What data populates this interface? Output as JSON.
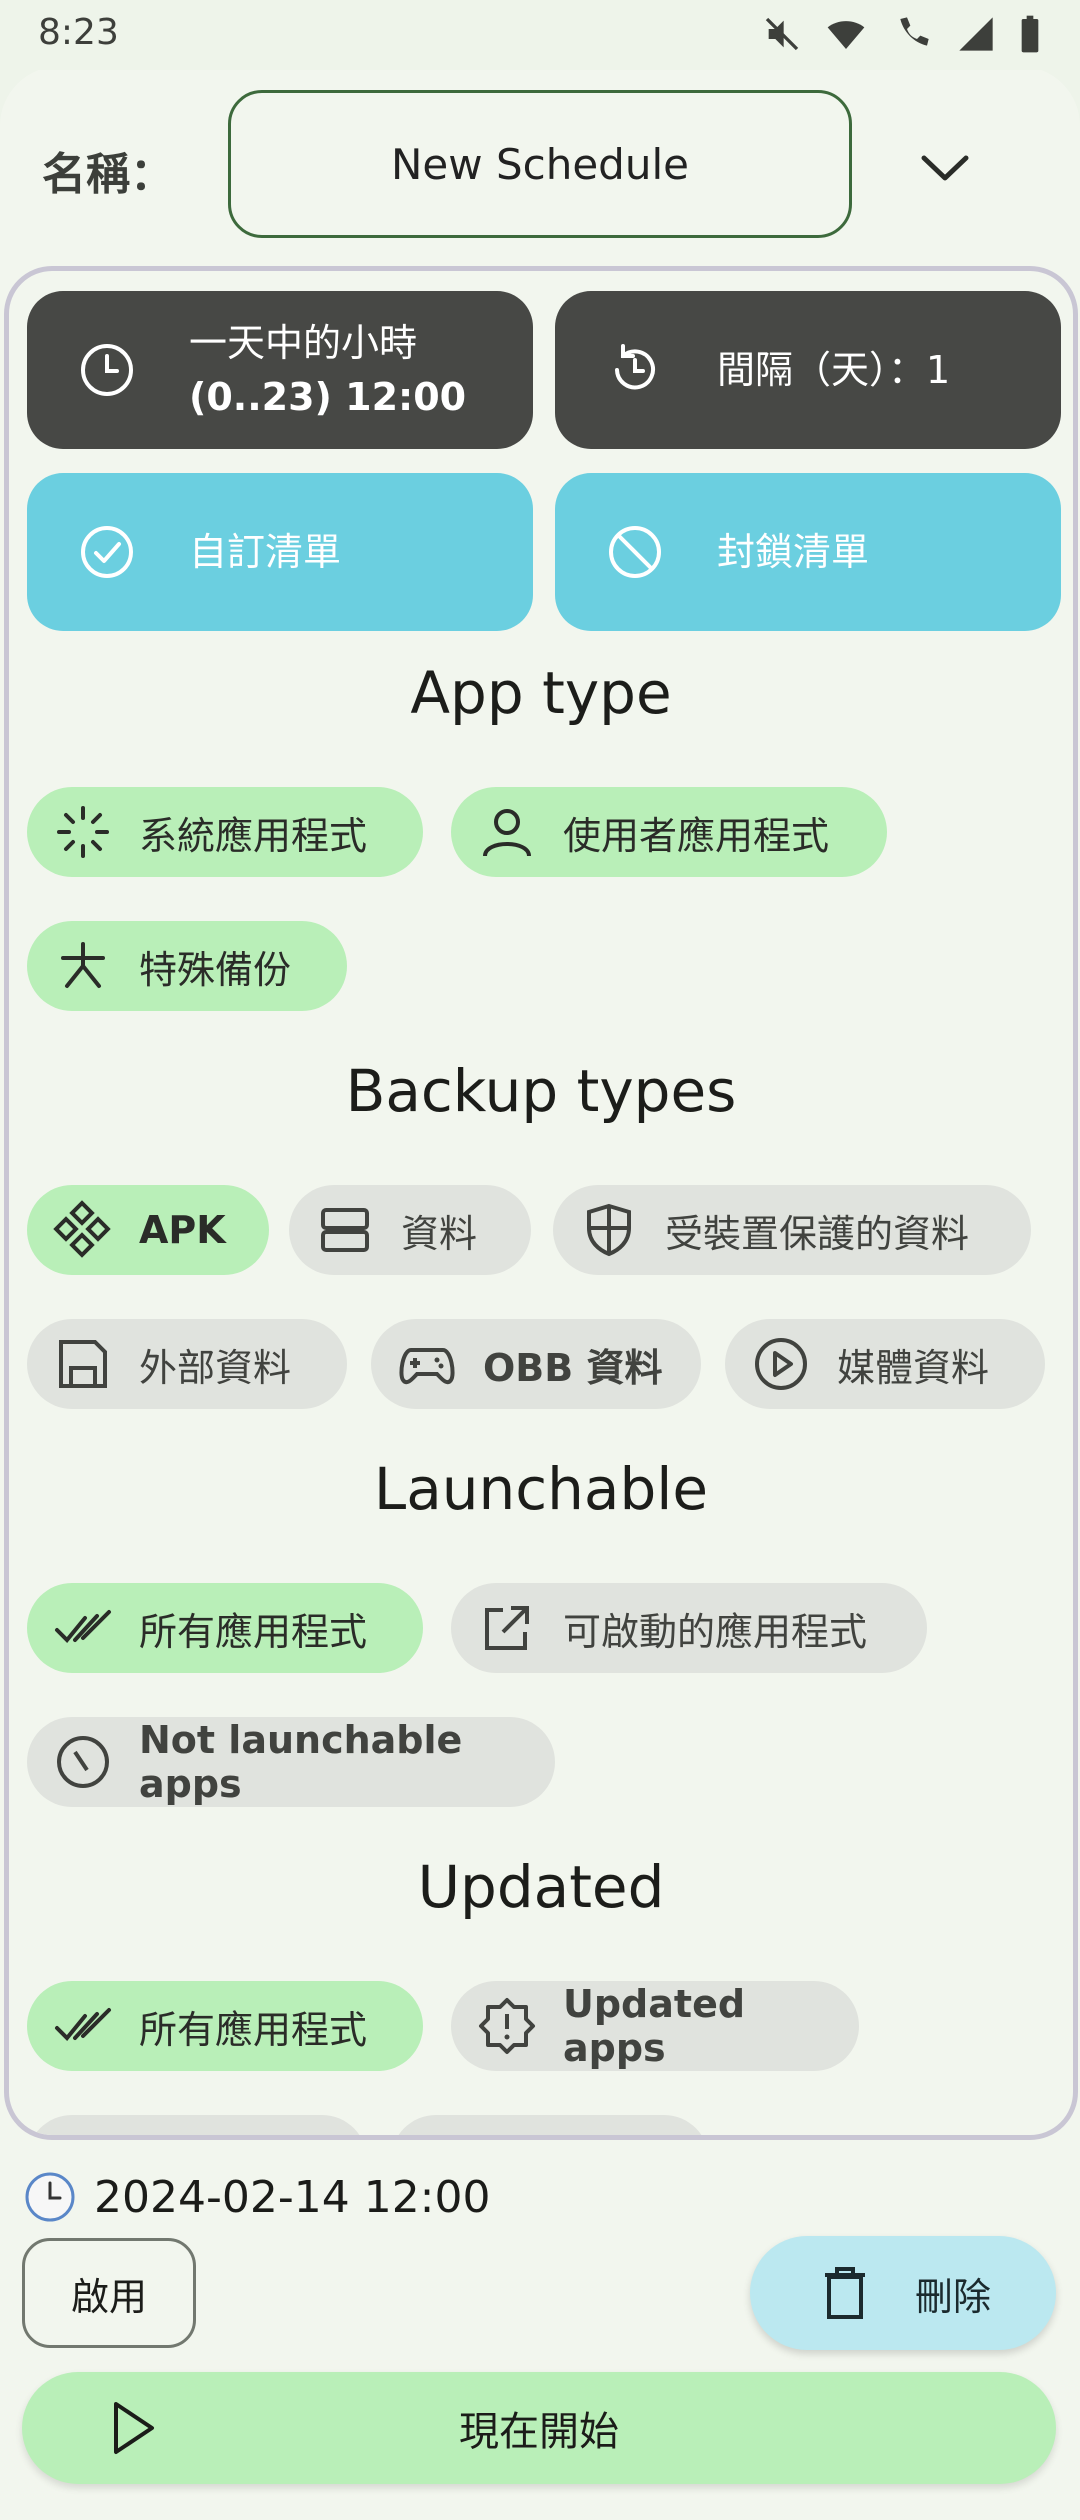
{
  "status_bar": {
    "time": "8:23",
    "icons": [
      "mute-icon",
      "wifi-icon",
      "wifi-call-icon",
      "signal-icon",
      "battery-icon"
    ]
  },
  "header": {
    "name_label": "名稱：",
    "name_value": "New Schedule",
    "dropdown_icon": "chevron-down-icon"
  },
  "schedule": {
    "hour_button": {
      "line1": "一天中的小時",
      "line2": "(0..23) 12:00",
      "icon": "clock-icon"
    },
    "interval_button": {
      "label": "間隔（天）：1",
      "icon": "history-icon"
    },
    "custom_list_button": {
      "label": "自訂清單",
      "icon": "check-circle-icon"
    },
    "block_list_button": {
      "label": "封鎖清單",
      "icon": "block-icon"
    }
  },
  "sections": {
    "app_type": {
      "title": "App type",
      "chips": [
        {
          "label": "系統應用程式",
          "icon": "spinner-icon",
          "selected": true
        },
        {
          "label": "使用者應用程式",
          "icon": "user-icon",
          "selected": true
        },
        {
          "label": "特殊備份",
          "icon": "asterisk-icon",
          "selected": true
        }
      ]
    },
    "backup_types": {
      "title": "Backup types",
      "chips": [
        {
          "label": "APK",
          "icon": "apk-icon",
          "selected": true
        },
        {
          "label": "資料",
          "icon": "storage-icon",
          "selected": false
        },
        {
          "label": "受裝置保護的資料",
          "icon": "shield-icon",
          "selected": false
        },
        {
          "label": "外部資料",
          "icon": "floppy-icon",
          "selected": false
        },
        {
          "label": "OBB 資料",
          "icon": "gamepad-icon",
          "selected": false
        },
        {
          "label": "媒體資料",
          "icon": "play-circle-icon",
          "selected": false
        }
      ]
    },
    "launchable": {
      "title": "Launchable",
      "chips": [
        {
          "label": "所有應用程式",
          "icon": "double-check-icon",
          "selected": true
        },
        {
          "label": "可啟動的應用程式",
          "icon": "external-link-icon",
          "selected": false
        },
        {
          "label": "Not launchable apps",
          "icon": "slash-circle-icon",
          "selected": false
        }
      ]
    },
    "updated": {
      "title": "Updated",
      "chips": [
        {
          "label": "所有應用程式",
          "icon": "double-check-icon",
          "selected": true
        },
        {
          "label": "Updated apps",
          "icon": "alert-badge-icon",
          "selected": false
        }
      ]
    }
  },
  "footer": {
    "next_time": "2024-02-14 12:00",
    "clock_icon": "clock-emoji-icon",
    "enable_label": "啟用",
    "delete_label": "刪除",
    "start_label": "現在開始"
  },
  "colors": {
    "background": "#eef4ea",
    "dark_button": "#474845",
    "cyan_button": "#6bcfe0",
    "chip_selected": "#b9efb8",
    "chip_unselected": "#e0e3de",
    "delete_button": "#bbe8f0",
    "field_border": "#3d6a3c"
  }
}
